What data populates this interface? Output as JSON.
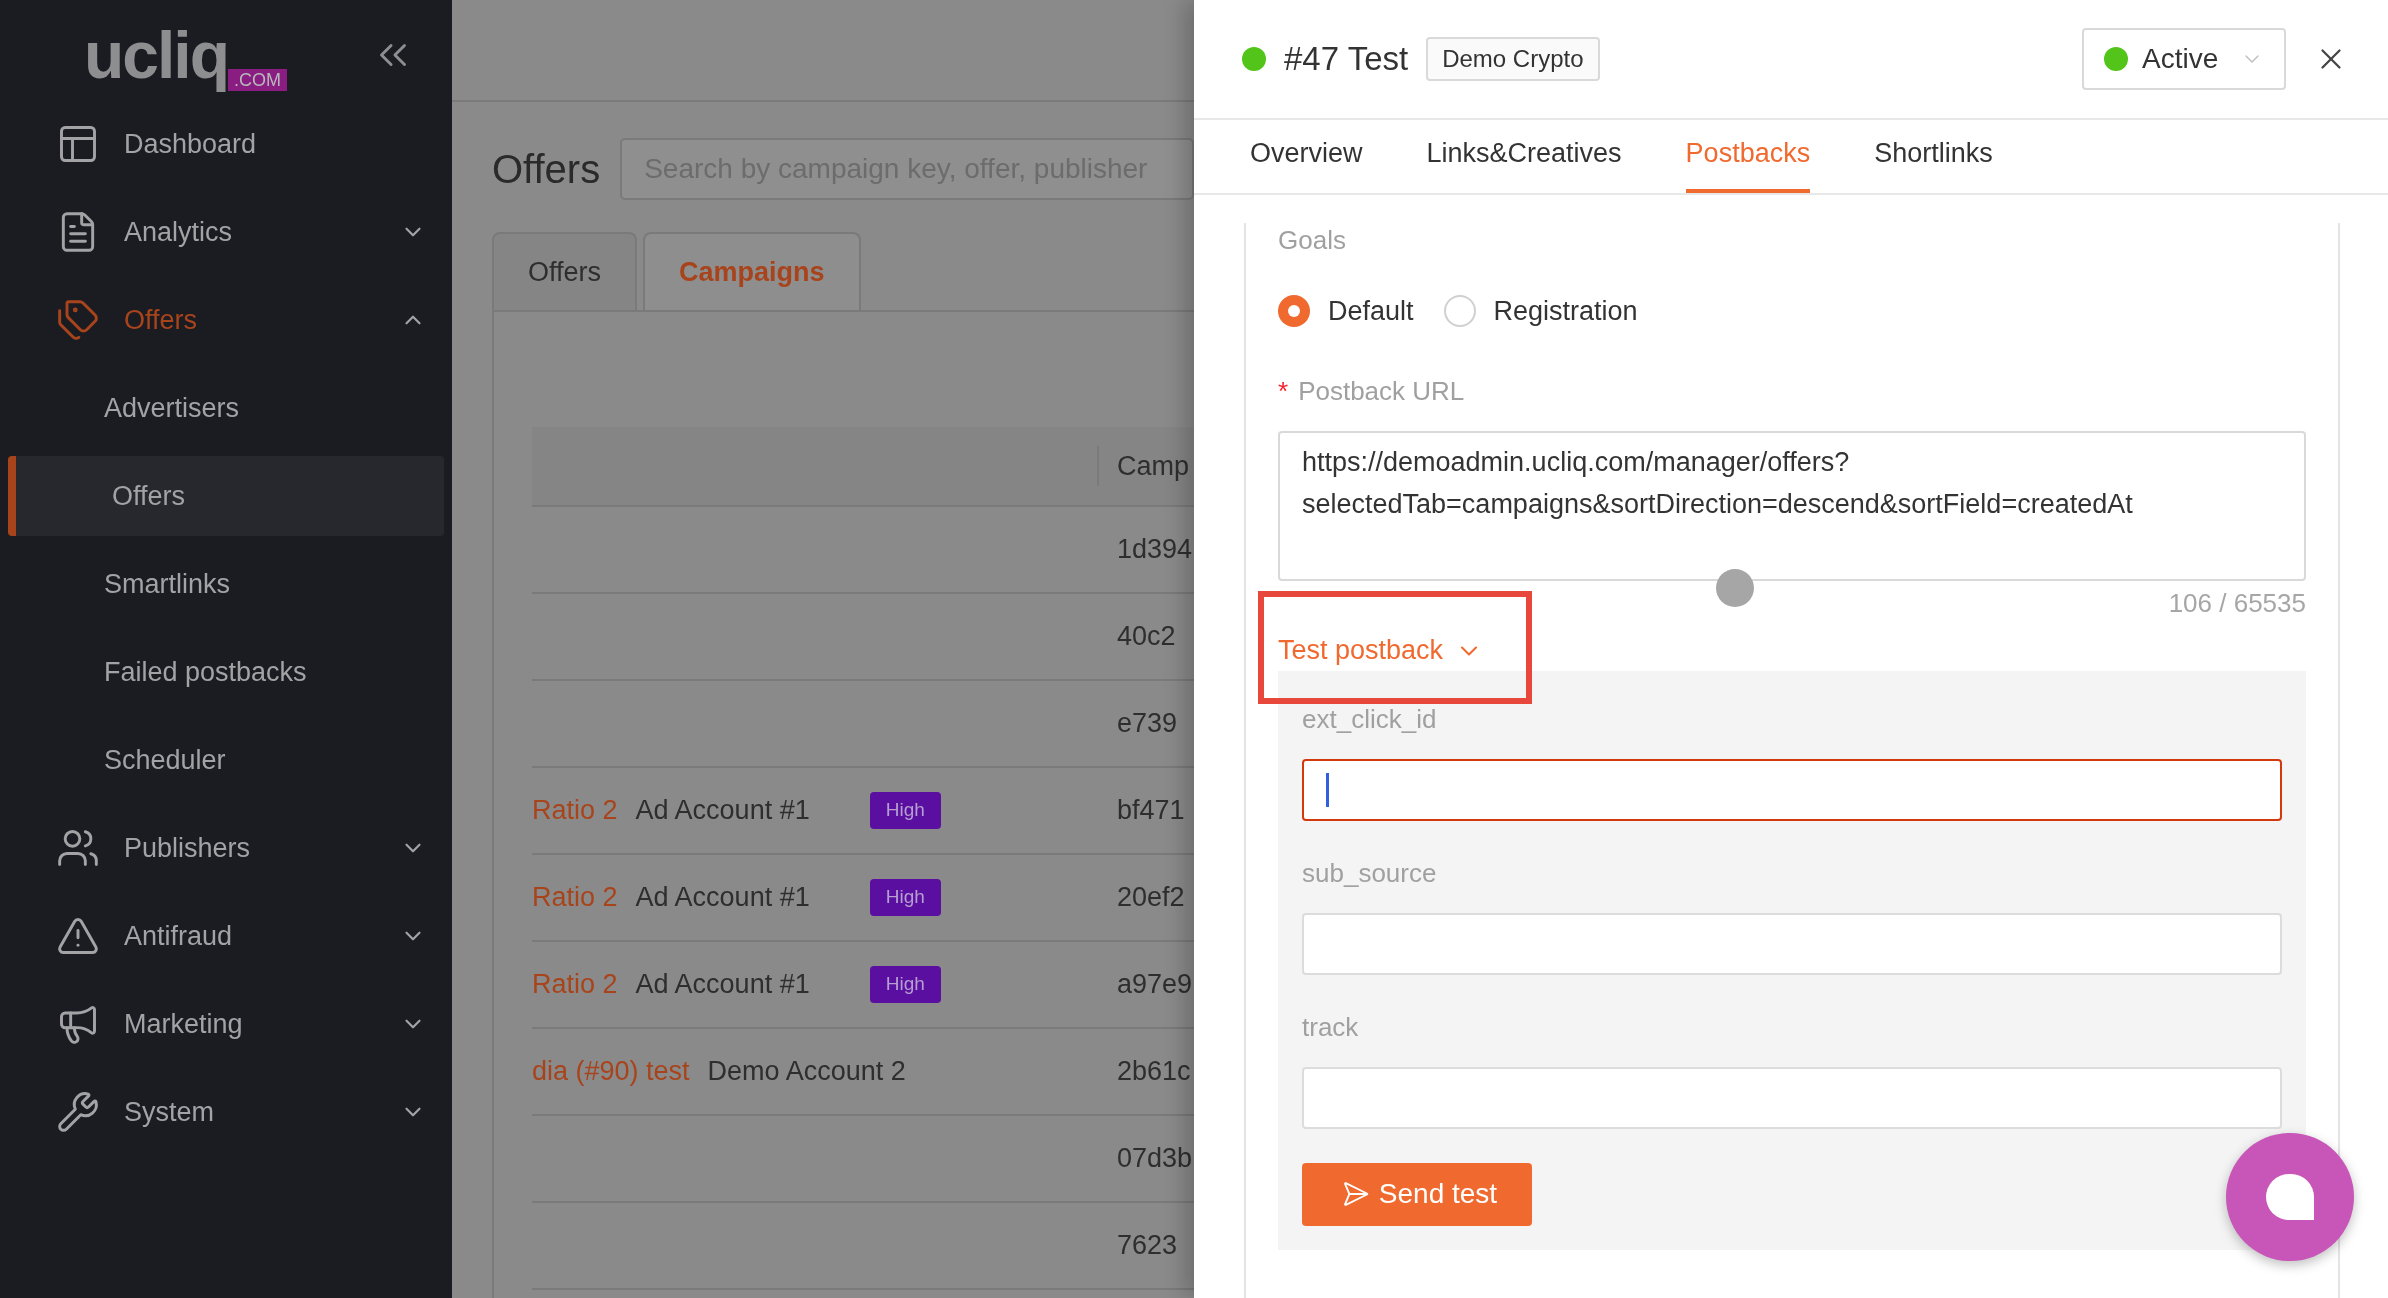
{
  "sidebar": {
    "logo": {
      "text": "ucliq",
      "suffix": ".COM"
    },
    "items": [
      {
        "label": "Dashboard",
        "kind": "link",
        "selected": false
      },
      {
        "label": "Analytics",
        "kind": "group",
        "expanded": false,
        "selected": false
      },
      {
        "label": "Offers",
        "kind": "group",
        "expanded": true,
        "selected": true,
        "children": [
          {
            "label": "Advertisers",
            "selected": false
          },
          {
            "label": "Offers",
            "selected": true
          },
          {
            "label": "Smartlinks",
            "selected": false
          },
          {
            "label": "Failed postbacks",
            "selected": false
          },
          {
            "label": "Scheduler",
            "selected": false
          }
        ]
      },
      {
        "label": "Publishers",
        "kind": "group",
        "expanded": false,
        "selected": false
      },
      {
        "label": "Antifraud",
        "kind": "group",
        "expanded": false,
        "selected": false
      },
      {
        "label": "Marketing",
        "kind": "group",
        "expanded": false,
        "selected": false
      },
      {
        "label": "System",
        "kind": "group",
        "expanded": false,
        "selected": false
      }
    ]
  },
  "page": {
    "title": "Offers",
    "search": {
      "placeholder": "Search by campaign key, offer, publisher"
    },
    "tabs": [
      {
        "label": "Offers",
        "selected": false
      },
      {
        "label": "Campaigns",
        "selected": true
      }
    ],
    "table": {
      "columns": [
        "Camp"
      ],
      "rows": [
        {
          "column_4": "1d394"
        },
        {
          "column_4": "40c2"
        },
        {
          "column_4": "e739"
        },
        {
          "column_1": "Ratio 2",
          "column_2": "Ad Account #1",
          "column_3": "High",
          "column_4": "bf471"
        },
        {
          "column_1": "Ratio 2",
          "column_2": "Ad Account #1",
          "column_3": "High",
          "column_4": "20ef2"
        },
        {
          "column_1": "Ratio 2",
          "column_2": "Ad Account #1",
          "column_3": "High",
          "column_4": "a97e9"
        },
        {
          "column_1": "dia (#90) test",
          "column_2": "Demo Account 2",
          "column_4": "2b61c"
        },
        {
          "column_4": "07d3b"
        },
        {
          "column_4": "7623"
        }
      ]
    }
  },
  "drawer": {
    "title": "#47 Test",
    "tag": "Demo Crypto",
    "status": "Active",
    "tabs": [
      {
        "label": "Overview",
        "selected": false
      },
      {
        "label": "Links&Creatives",
        "selected": false
      },
      {
        "label": "Postbacks",
        "selected": true
      },
      {
        "label": "Shortlinks",
        "selected": false
      }
    ],
    "goals": {
      "label": "Goals",
      "options": [
        {
          "label": "Default",
          "selected": true
        },
        {
          "label": "Registration",
          "selected": false
        }
      ]
    },
    "postback_url": {
      "label": "Postback URL",
      "required_mark": "*",
      "value": "https://demoadmin.ucliq.com/manager/offers?selectedTab=campaigns&sortDirection=descend&sortField=createdAt",
      "counter": "106 / 65535"
    },
    "test_postback": {
      "label": "Test postback",
      "expanded": true,
      "fields": [
        {
          "label": "ext_click_id",
          "focused": true
        },
        {
          "label": "sub_source",
          "focused": false
        },
        {
          "label": "track",
          "focused": false
        }
      ],
      "button": "Send test"
    }
  }
}
